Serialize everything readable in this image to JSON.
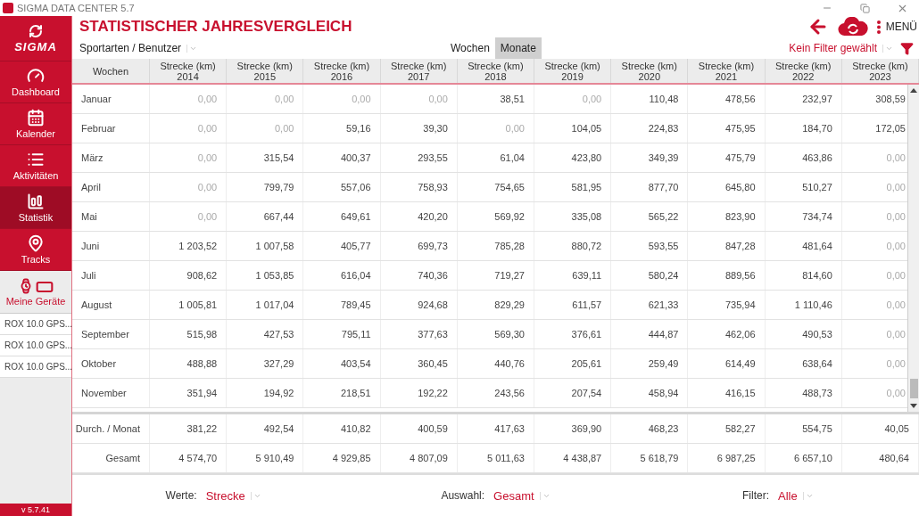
{
  "window": {
    "title": "SIGMA DATA CENTER 5.7"
  },
  "sidebar": {
    "logo": "SIGMA",
    "items": [
      {
        "label": "Dashboard",
        "kind": "dashboard",
        "selected": false
      },
      {
        "label": "Kalender",
        "kind": "calendar",
        "selected": false
      },
      {
        "label": "Aktivitäten",
        "kind": "list",
        "selected": false
      },
      {
        "label": "Statistik",
        "kind": "stats",
        "selected": true
      },
      {
        "label": "Tracks",
        "kind": "tracks",
        "selected": false
      }
    ],
    "devices_header": "Meine Geräte",
    "devices": [
      "ROX 10.0 GPS...",
      "ROX 10.0 GPS...",
      "ROX 10.0 GPS..."
    ],
    "version": "v 5.7.41"
  },
  "header": {
    "title": "STATISTISCHER JAHRESVERGLEICH",
    "menu": "MENÜ",
    "sport_select": "Sportarten / Benutzer",
    "view_tabs": [
      {
        "label": "Wochen",
        "selected": false
      },
      {
        "label": "Monate",
        "selected": true
      }
    ],
    "filter": "Kein Filter gewählt"
  },
  "table": {
    "columns": [
      [
        "Wochen"
      ],
      [
        "Strecke (km)",
        "2014"
      ],
      [
        "Strecke (km)",
        "2015"
      ],
      [
        "Strecke (km)",
        "2016"
      ],
      [
        "Strecke (km)",
        "2017"
      ],
      [
        "Strecke (km)",
        "2018"
      ],
      [
        "Strecke (km)",
        "2019"
      ],
      [
        "Strecke (km)",
        "2020"
      ],
      [
        "Strecke (km)",
        "2021"
      ],
      [
        "Strecke (km)",
        "2022"
      ],
      [
        "Strecke (km)",
        "2023"
      ]
    ],
    "rows": [
      {
        "label": "Januar",
        "values": [
          "0,00",
          "0,00",
          "0,00",
          "0,00",
          "38,51",
          "0,00",
          "110,48",
          "478,56",
          "232,97",
          "308,59"
        ]
      },
      {
        "label": "Februar",
        "values": [
          "0,00",
          "0,00",
          "59,16",
          "39,30",
          "0,00",
          "104,05",
          "224,83",
          "475,95",
          "184,70",
          "172,05"
        ]
      },
      {
        "label": "März",
        "values": [
          "0,00",
          "315,54",
          "400,37",
          "293,55",
          "61,04",
          "423,80",
          "349,39",
          "475,79",
          "463,86",
          "0,00"
        ]
      },
      {
        "label": "April",
        "values": [
          "0,00",
          "799,79",
          "557,06",
          "758,93",
          "754,65",
          "581,95",
          "877,70",
          "645,80",
          "510,27",
          "0,00"
        ]
      },
      {
        "label": "Mai",
        "values": [
          "0,00",
          "667,44",
          "649,61",
          "420,20",
          "569,92",
          "335,08",
          "565,22",
          "823,90",
          "734,74",
          "0,00"
        ]
      },
      {
        "label": "Juni",
        "values": [
          "1 203,52",
          "1 007,58",
          "405,77",
          "699,73",
          "785,28",
          "880,72",
          "593,55",
          "847,28",
          "481,64",
          "0,00"
        ]
      },
      {
        "label": "Juli",
        "values": [
          "908,62",
          "1 053,85",
          "616,04",
          "740,36",
          "719,27",
          "639,11",
          "580,24",
          "889,56",
          "814,60",
          "0,00"
        ]
      },
      {
        "label": "August",
        "values": [
          "1 005,81",
          "1 017,04",
          "789,45",
          "924,68",
          "829,29",
          "611,57",
          "621,33",
          "735,94",
          "1 110,46",
          "0,00"
        ]
      },
      {
        "label": "September",
        "values": [
          "515,98",
          "427,53",
          "795,11",
          "377,63",
          "569,30",
          "376,61",
          "444,87",
          "462,06",
          "490,53",
          "0,00"
        ]
      },
      {
        "label": "Oktober",
        "values": [
          "488,88",
          "327,29",
          "403,54",
          "360,45",
          "440,76",
          "205,61",
          "259,49",
          "614,49",
          "638,64",
          "0,00"
        ]
      },
      {
        "label": "November",
        "values": [
          "351,94",
          "194,92",
          "218,51",
          "192,22",
          "243,56",
          "207,54",
          "458,94",
          "416,15",
          "488,73",
          "0,00"
        ]
      }
    ],
    "summary": [
      {
        "label": "Durch. / Monat",
        "values": [
          "381,22",
          "492,54",
          "410,82",
          "400,59",
          "417,63",
          "369,90",
          "468,23",
          "582,27",
          "554,75",
          "40,05"
        ]
      },
      {
        "label": "Gesamt",
        "values": [
          "4 574,70",
          "5 910,49",
          "4 929,85",
          "4 807,09",
          "5 011,63",
          "4 438,87",
          "5 618,79",
          "6 987,25",
          "6 657,10",
          "480,64"
        ]
      }
    ]
  },
  "footer": [
    {
      "label": "Werte:",
      "value": "Strecke"
    },
    {
      "label": "Auswahl:",
      "value": "Gesamt"
    },
    {
      "label": "Filter:",
      "value": "Alle"
    }
  ]
}
